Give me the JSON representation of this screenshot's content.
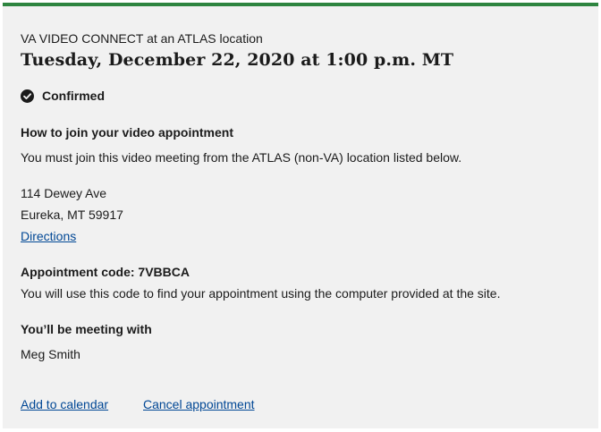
{
  "appointment": {
    "type_label": "VA VIDEO CONNECT at an ATLAS location",
    "datetime": "Tuesday, December 22, 2020 at 1:00 p.m. MT",
    "status": {
      "icon": "check-circle-icon",
      "label": "Confirmed"
    },
    "join": {
      "heading": "How to join your video appointment",
      "instructions": "You must join this video meeting from the ATLAS (non-VA) location listed below."
    },
    "location": {
      "street": "114 Dewey Ave",
      "city_state_zip": "Eureka, MT 59917",
      "directions_label": "Directions"
    },
    "code": {
      "heading": "Appointment code: 7VBBCA",
      "note": "You will use this code to find your appointment using the computer provided at the site."
    },
    "provider": {
      "heading": "You’ll be meeting with",
      "name": "Meg Smith"
    },
    "actions": {
      "add_to_calendar": "Add to calendar",
      "cancel": "Cancel appointment"
    }
  },
  "colors": {
    "accent_border": "#2e8540",
    "card_background": "#f1f1f1",
    "link": "#004795",
    "text": "#1b1b1b"
  }
}
